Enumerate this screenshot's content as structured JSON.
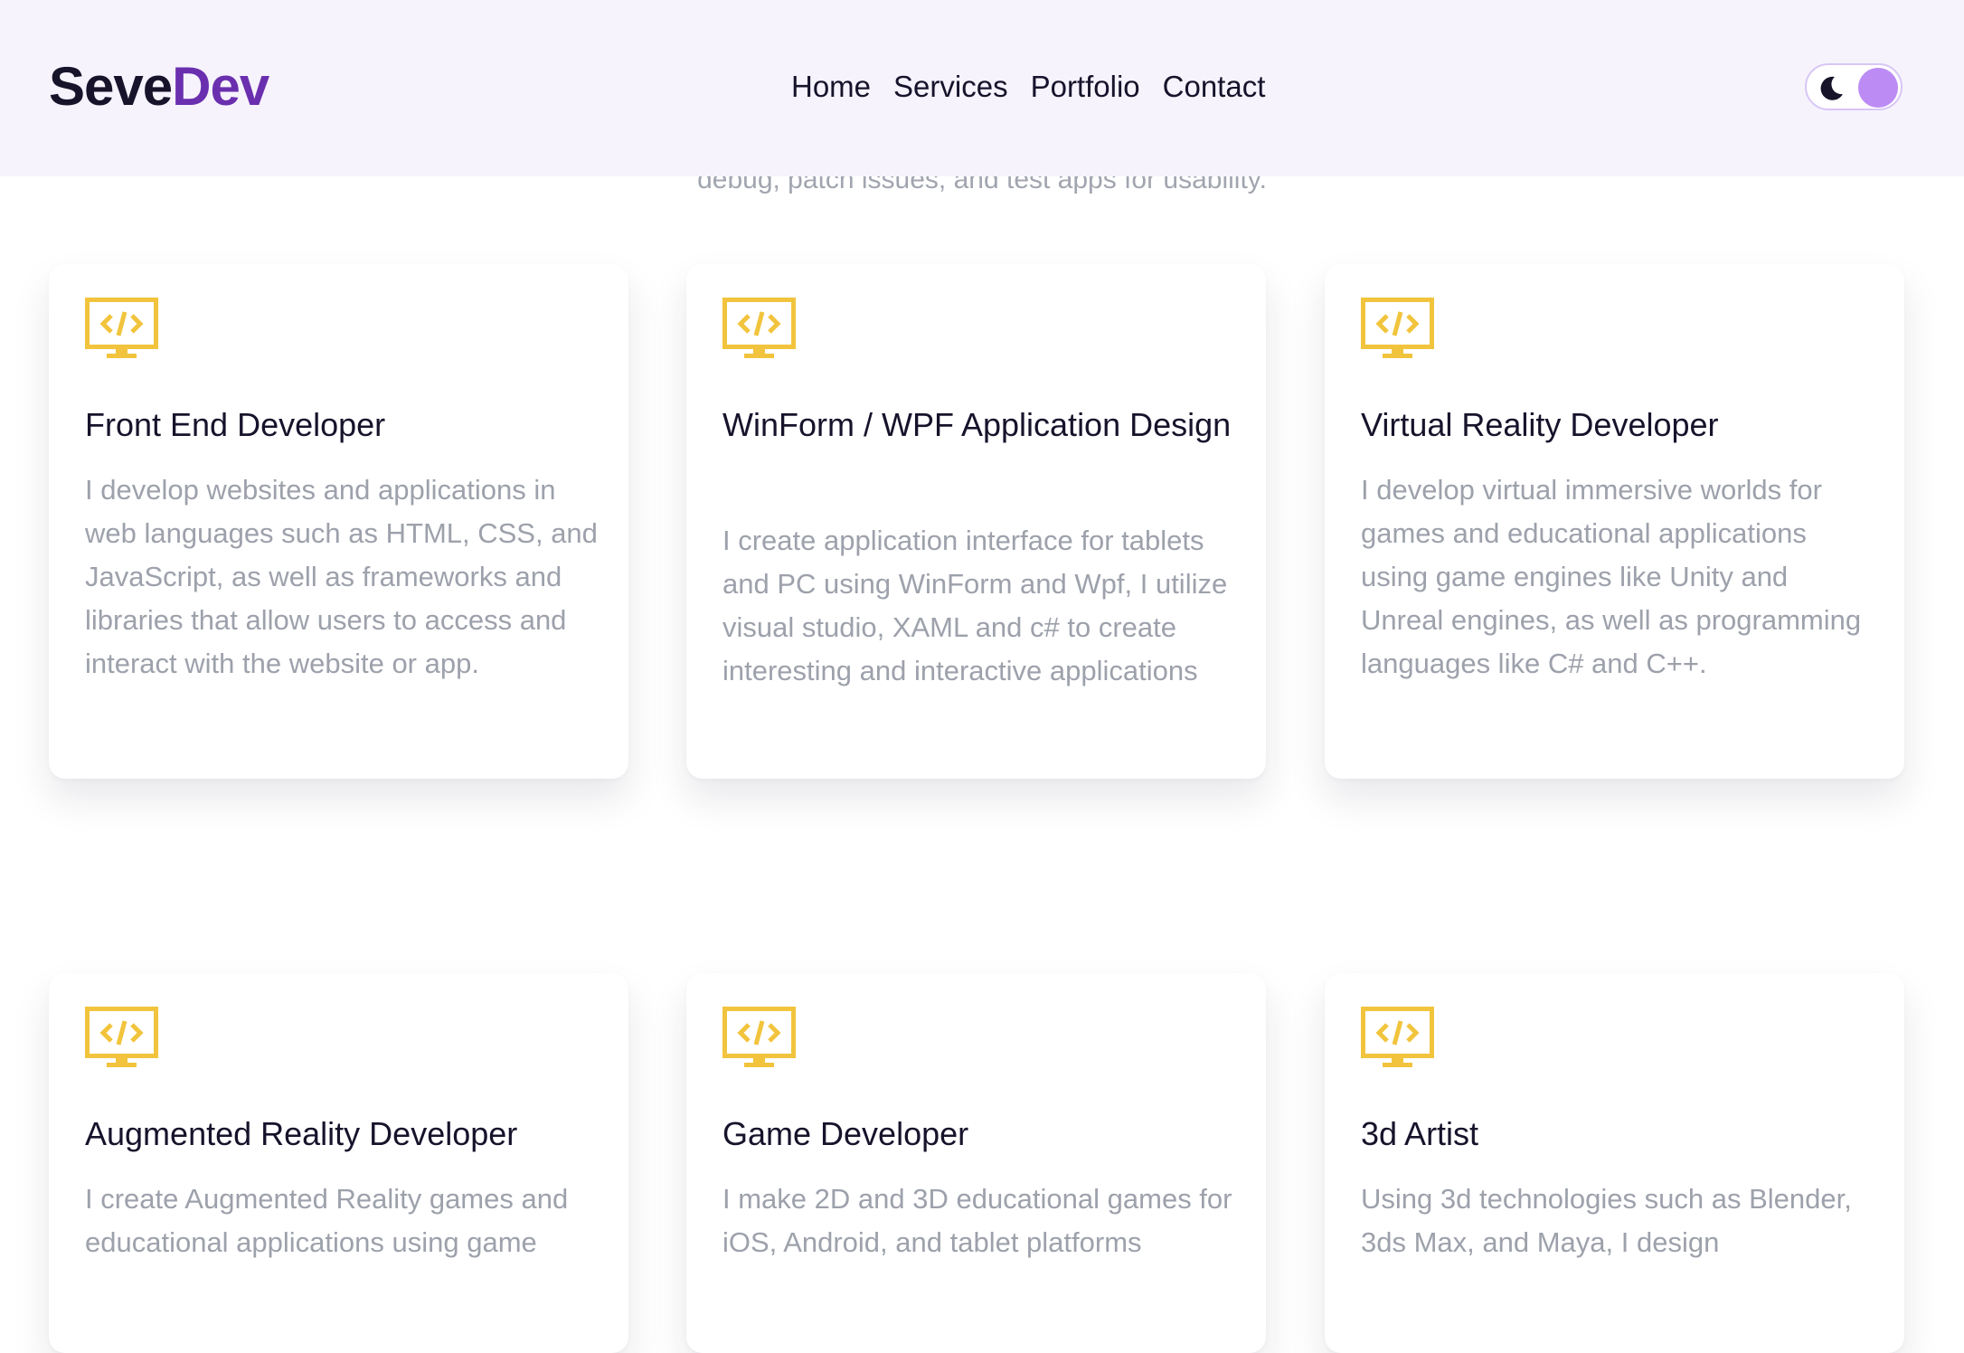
{
  "brand": {
    "part1": "Seve",
    "part2": "Dev",
    "accent_color": "#6a2fae"
  },
  "nav": {
    "items": [
      "Home",
      "Services",
      "Portfolio",
      "Contact"
    ]
  },
  "theme_toggle": {
    "icon": "moon-icon",
    "knob_color": "#bc8bf4"
  },
  "intro": {
    "text": "debug, patch issues, and test apps for usability."
  },
  "services": {
    "icon": "code-monitor-icon",
    "icon_color": "#f2c43d",
    "items": [
      {
        "title": "Front End Developer",
        "description": "I develop websites and applications in web languages such as HTML, CSS, and JavaScript, as well as frameworks and libraries that allow users to access and interact with the website or app."
      },
      {
        "title": "WinForm / WPF Application Design",
        "description": "I create application interface for tablets and PC using WinForm and Wpf, I utilize visual studio, XAML and c# to create interesting and interactive applications"
      },
      {
        "title": "Virtual Reality Developer",
        "description": "I develop virtual immersive worlds for games and educational applications using game engines like Unity and Unreal engines, as well as programming languages like C# and C++."
      },
      {
        "title": "Augmented Reality Developer",
        "description": "I create Augmented Reality games and educational applications using game"
      },
      {
        "title": "Game Developer",
        "description": "I make 2D and 3D educational games for iOS, Android, and tablet platforms"
      },
      {
        "title": "3d Artist",
        "description": "Using 3d technologies such as Blender, 3ds Max, and Maya, I design"
      }
    ]
  }
}
